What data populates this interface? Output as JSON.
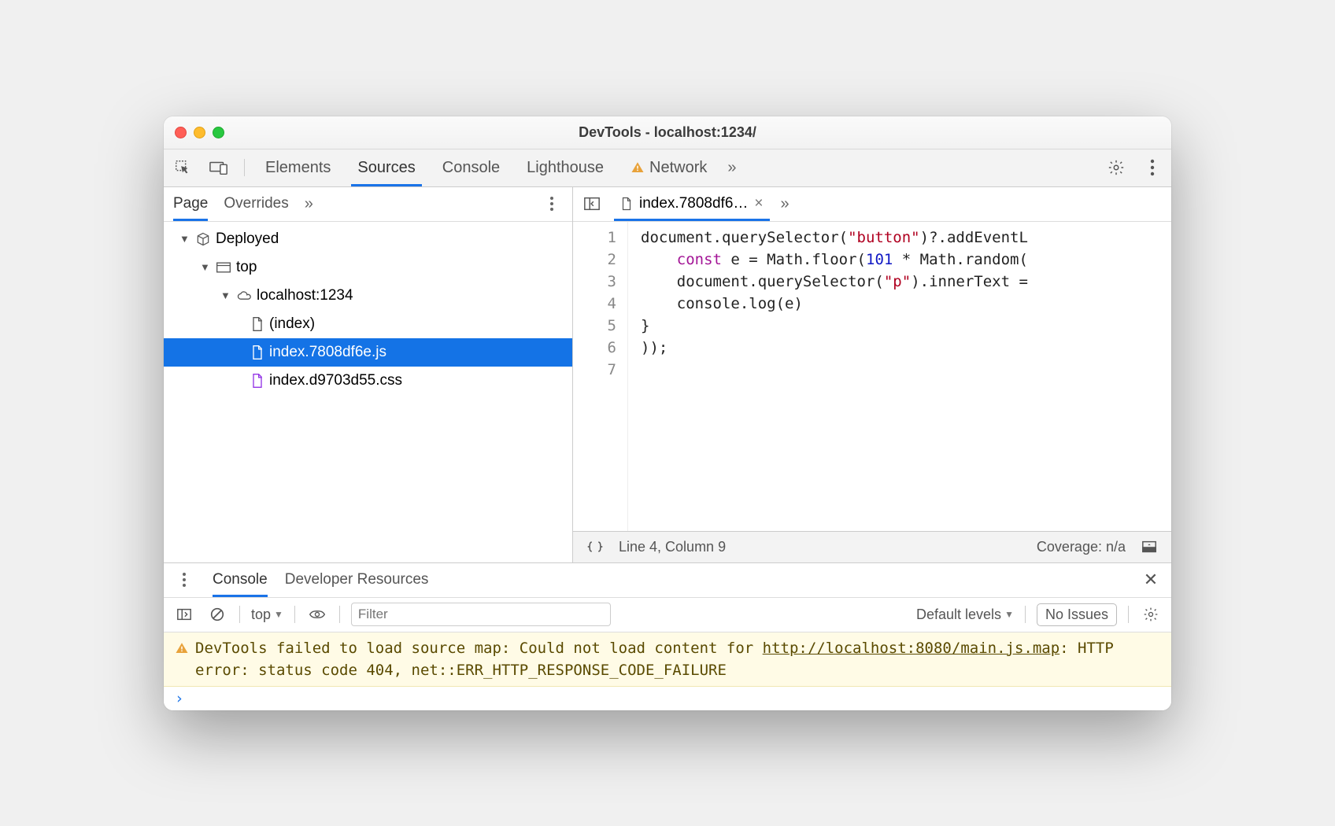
{
  "window": {
    "title": "DevTools - localhost:1234/"
  },
  "toolbar": {
    "tabs": [
      "Elements",
      "Sources",
      "Console",
      "Lighthouse",
      "Network"
    ],
    "active": "Sources",
    "has_warning_on": "Network"
  },
  "left": {
    "tabs": [
      "Page",
      "Overrides"
    ],
    "active": "Page",
    "tree": {
      "root": "Deployed",
      "top": "top",
      "origin": "localhost:1234",
      "files": [
        {
          "name": "(index)",
          "kind": "doc"
        },
        {
          "name": "index.7808df6e.js",
          "kind": "js",
          "selected": true
        },
        {
          "name": "index.d9703d55.css",
          "kind": "css"
        }
      ]
    }
  },
  "editor": {
    "tab": "index.7808df6…",
    "lines": [
      "document.querySelector(\"button\")?.addEventL",
      "    const e = Math.floor(101 * Math.random(",
      "    document.querySelector(\"p\").innerText =",
      "    console.log(e)",
      "}",
      "));",
      ""
    ],
    "status": {
      "cursor": "Line 4, Column 9",
      "coverage": "Coverage: n/a"
    }
  },
  "drawer": {
    "tabs": [
      "Console",
      "Developer Resources"
    ],
    "active": "Console",
    "toolbar": {
      "context": "top",
      "filter_placeholder": "Filter",
      "levels": "Default levels",
      "issues": "No Issues"
    },
    "warning": {
      "prefix": "DevTools failed to load source map: Could not load content for ",
      "link": "http://localhost:8080/main.js.map",
      "suffix": ": HTTP error: status code 404, net::ERR_HTTP_RESPONSE_CODE_FAILURE"
    }
  }
}
